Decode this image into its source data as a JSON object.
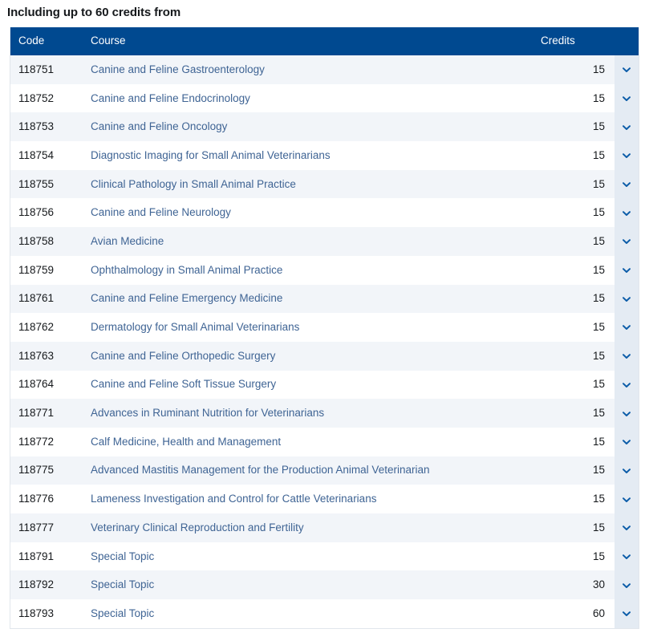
{
  "section": {
    "title": "Including up to 60 credits from"
  },
  "table": {
    "columns": {
      "code": "Code",
      "course": "Course",
      "credits": "Credits",
      "toggle": ""
    },
    "toggle_icon": "chevron-down-icon",
    "rows": [
      {
        "code": "118751",
        "course": "Canine and Feline Gastroenterology",
        "credits": "15"
      },
      {
        "code": "118752",
        "course": "Canine and Feline Endocrinology",
        "credits": "15"
      },
      {
        "code": "118753",
        "course": "Canine and Feline Oncology",
        "credits": "15"
      },
      {
        "code": "118754",
        "course": "Diagnostic Imaging for Small Animal Veterinarians",
        "credits": "15"
      },
      {
        "code": "118755",
        "course": "Clinical Pathology in Small Animal Practice",
        "credits": "15"
      },
      {
        "code": "118756",
        "course": "Canine and Feline Neurology",
        "credits": "15"
      },
      {
        "code": "118758",
        "course": "Avian Medicine",
        "credits": "15"
      },
      {
        "code": "118759",
        "course": "Ophthalmology in Small Animal Practice",
        "credits": "15"
      },
      {
        "code": "118761",
        "course": "Canine and Feline Emergency Medicine",
        "credits": "15"
      },
      {
        "code": "118762",
        "course": "Dermatology for Small Animal Veterinarians",
        "credits": "15"
      },
      {
        "code": "118763",
        "course": "Canine and Feline Orthopedic Surgery",
        "credits": "15"
      },
      {
        "code": "118764",
        "course": "Canine and Feline Soft Tissue Surgery",
        "credits": "15"
      },
      {
        "code": "118771",
        "course": "Advances in Ruminant Nutrition for Veterinarians",
        "credits": "15"
      },
      {
        "code": "118772",
        "course": "Calf Medicine, Health and Management",
        "credits": "15"
      },
      {
        "code": "118775",
        "course": "Advanced Mastitis Management for the Production Animal Veterinarian",
        "credits": "15"
      },
      {
        "code": "118776",
        "course": "Lameness Investigation and Control for Cattle Veterinarians",
        "credits": "15"
      },
      {
        "code": "118777",
        "course": "Veterinary Clinical Reproduction and Fertility",
        "credits": "15"
      },
      {
        "code": "118791",
        "course": "Special Topic",
        "credits": "15"
      },
      {
        "code": "118792",
        "course": "Special Topic",
        "credits": "30"
      },
      {
        "code": "118793",
        "course": "Special Topic",
        "credits": "60"
      }
    ]
  },
  "colors": {
    "header_bg": "#004990",
    "row_alt_bg": "#f2f5f9",
    "toggle_bg": "#e4ebf3",
    "link": "#3f6494",
    "text": "#16191c"
  }
}
